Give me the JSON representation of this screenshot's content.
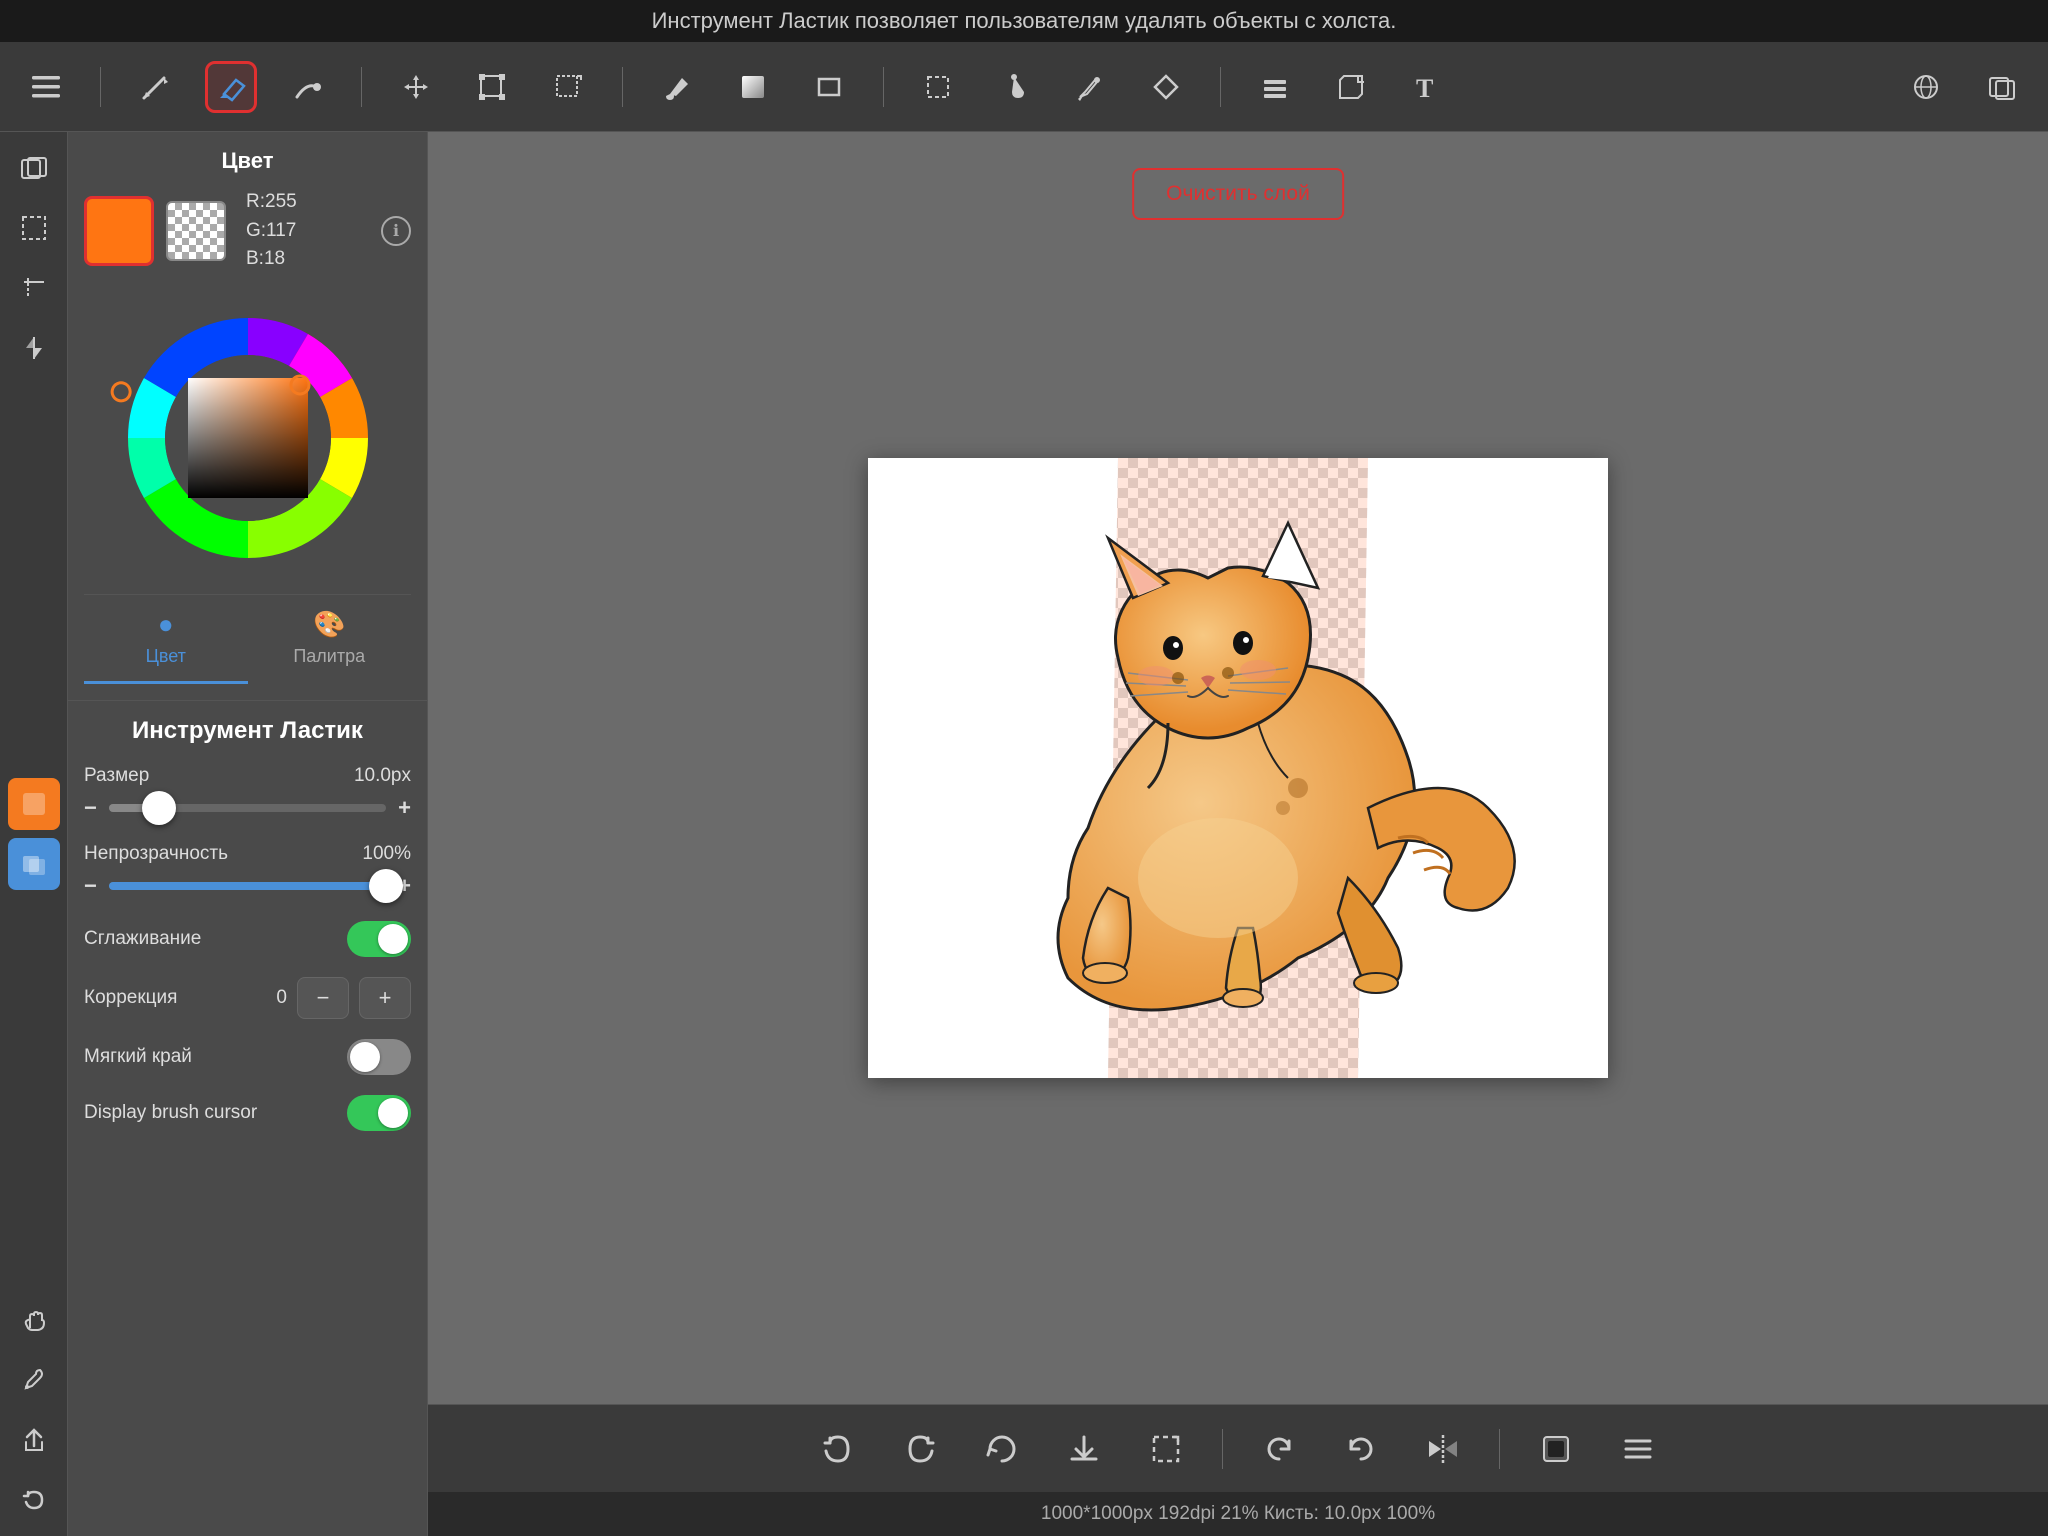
{
  "statusBar": {
    "text": "Инструмент Ластик позволяет пользователям удалять объекты с холста."
  },
  "toolbar": {
    "icons": [
      "✏️",
      "◆",
      "✏",
      "✥",
      "⊡",
      "⊠",
      "⬟",
      "⬡",
      "▭",
      "⊹",
      "✦",
      "✒",
      "◇",
      "⊞",
      "⊟",
      "T"
    ],
    "rightIcons": [
      "🌐",
      "⧉"
    ]
  },
  "leftStrip": {
    "icons": [
      "⊞",
      "⬚",
      "⋮",
      "↩",
      "⊕",
      "☁",
      "⊙",
      "✋",
      "✒",
      "↪",
      "↩"
    ]
  },
  "colorPanel": {
    "title": "Цвет",
    "primaryColor": "#ff7512",
    "rgb": {
      "r": 255,
      "g": 117,
      "b": 18
    },
    "rgbText": "R:255\nG:117\nB:18",
    "tabs": [
      {
        "id": "color",
        "label": "Цвет",
        "active": true
      },
      {
        "id": "palette",
        "label": "Палитра",
        "active": false
      }
    ]
  },
  "toolSection": {
    "title": "Инструмент Ластик",
    "size": {
      "label": "Размер",
      "value": "10.0px",
      "percent": 18,
      "thumbLeft": 18
    },
    "opacity": {
      "label": "Непрозрачность",
      "value": "100%",
      "percent": 100,
      "thumbLeft": 100
    },
    "smoothing": {
      "label": "Сглаживание",
      "on": true
    },
    "correction": {
      "label": "Коррекция",
      "value": "0"
    },
    "softEdge": {
      "label": "Мягкий край",
      "on": false
    },
    "displayBrushCursor": {
      "label": "Display brush cursor",
      "on": true
    }
  },
  "canvas": {
    "clearButton": "Очистить слой",
    "statusText": "1000*1000px 192dpi 21% Кисть: 10.0px 100%"
  },
  "bottomToolbar": {
    "icons": [
      "↩",
      "↪",
      "⟳",
      "⬇",
      "⬚",
      "↺",
      "↻",
      "⊘",
      "⬛",
      "≡"
    ]
  }
}
